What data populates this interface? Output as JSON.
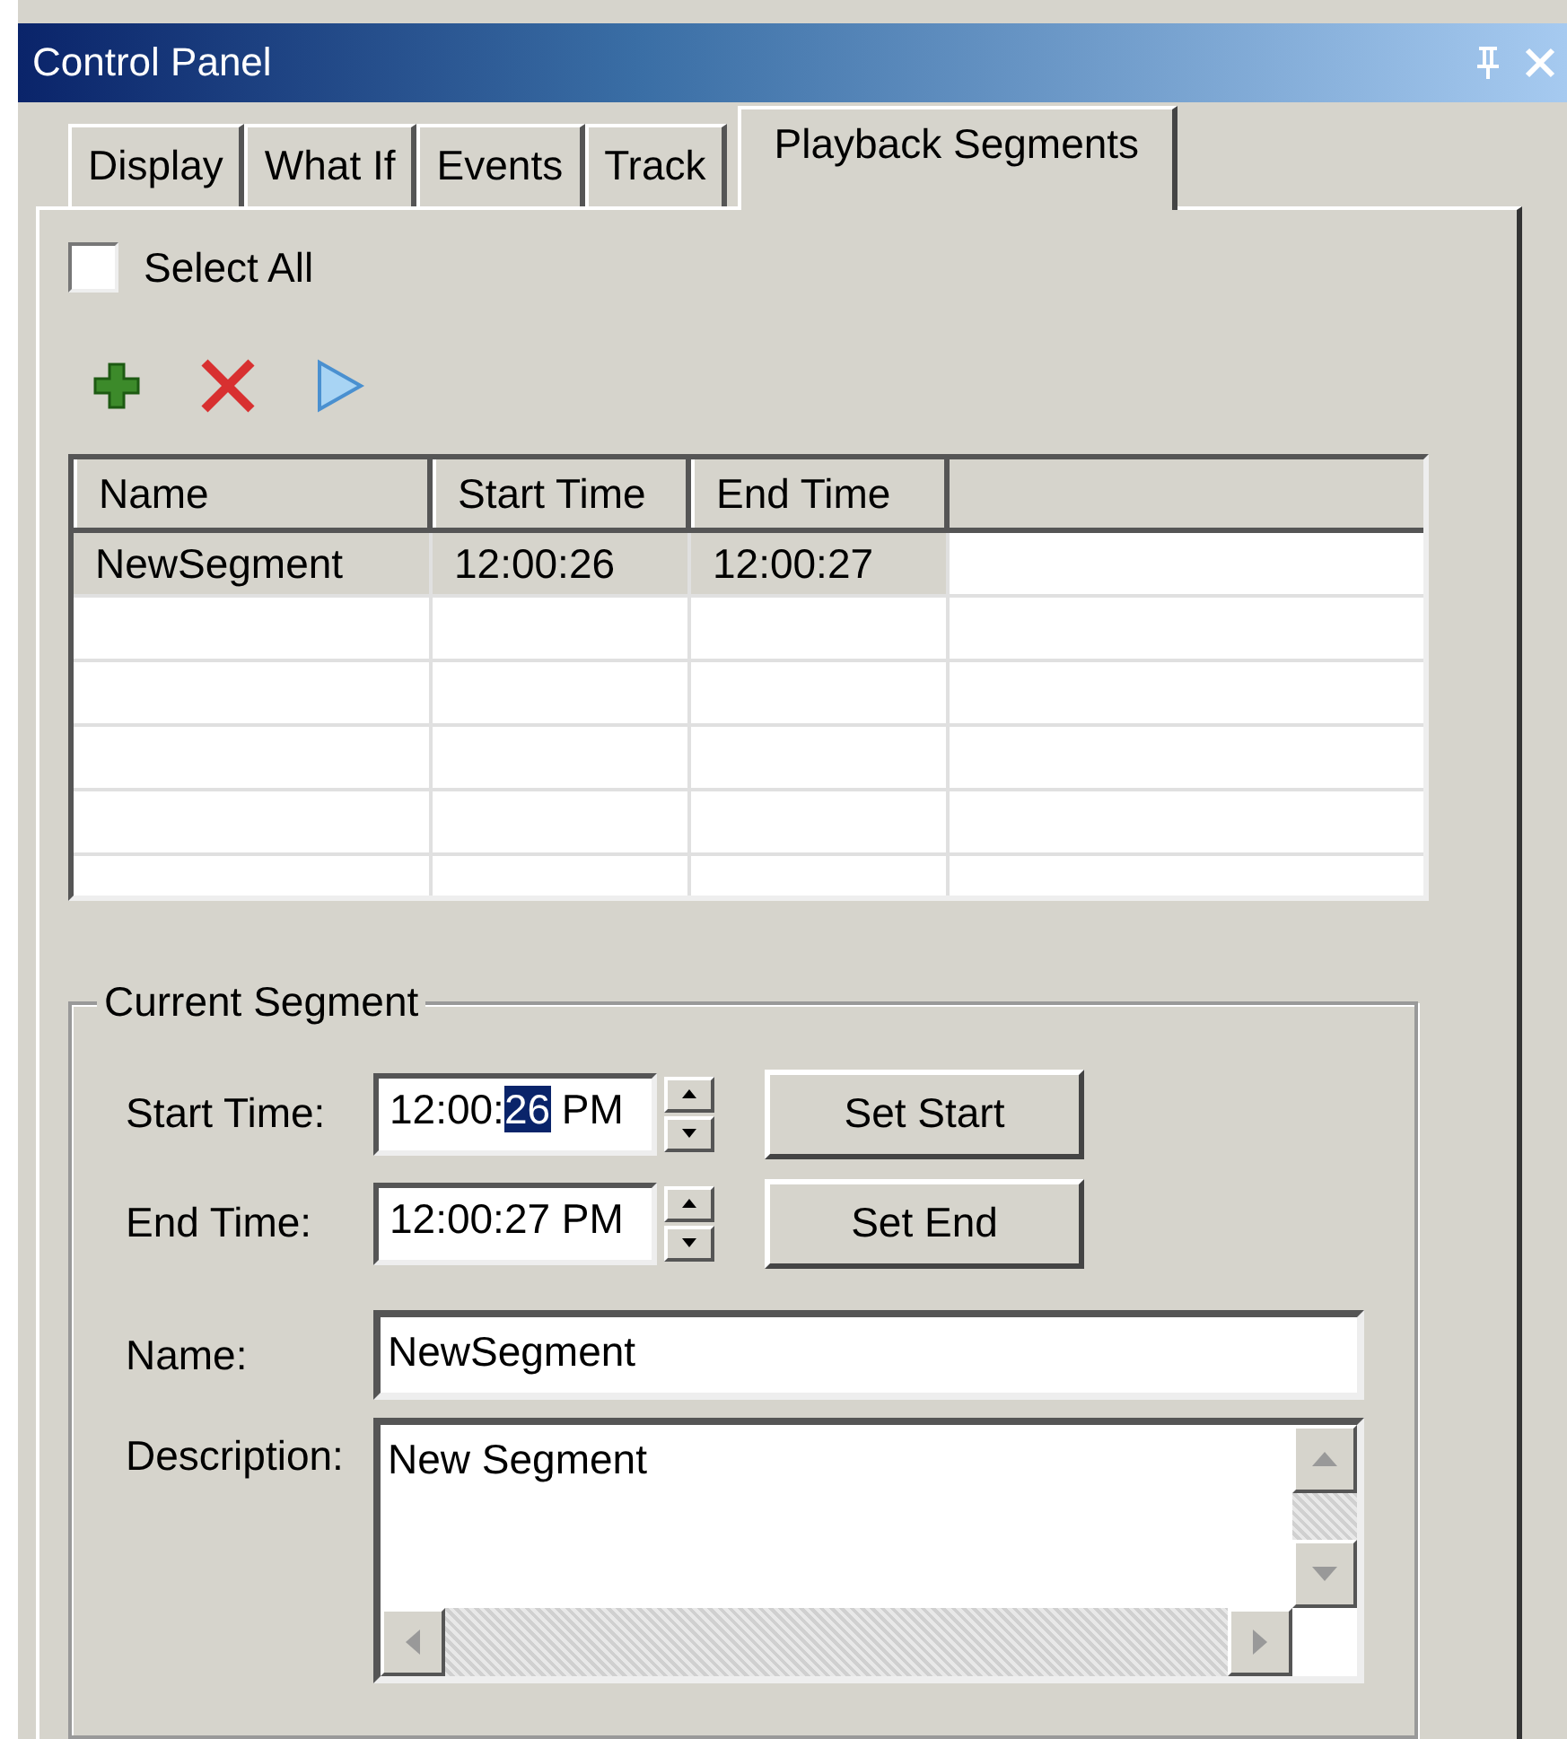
{
  "window": {
    "title": "Control Panel"
  },
  "tabs": [
    {
      "label": "Display",
      "selected": false
    },
    {
      "label": "What If",
      "selected": false
    },
    {
      "label": "Events",
      "selected": false
    },
    {
      "label": "Track",
      "selected": false
    },
    {
      "label": "Playback Segments",
      "selected": true
    }
  ],
  "select_all": {
    "label": "Select All",
    "checked": false
  },
  "table": {
    "columns": [
      "Name",
      "Start Time",
      "End Time"
    ],
    "rows": [
      {
        "cells": [
          "NewSegment",
          "12:00:26",
          "12:00:27"
        ],
        "selected": true
      }
    ]
  },
  "current_segment": {
    "title": "Current Segment",
    "times": [
      {
        "label": "Start Time:",
        "value_parts": [
          {
            "text": "12:00:",
            "selected": false
          },
          {
            "text": "26",
            "selected": true
          },
          {
            "text": " PM",
            "selected": false
          }
        ],
        "button": "Set Start"
      },
      {
        "label": "End Time:",
        "value_parts": [
          {
            "text": "12:00:27 PM",
            "selected": false
          }
        ],
        "button": "Set End"
      }
    ],
    "name": {
      "label": "Name:",
      "value": "NewSegment"
    },
    "description": {
      "label": "Description:",
      "value": "New Segment"
    }
  }
}
